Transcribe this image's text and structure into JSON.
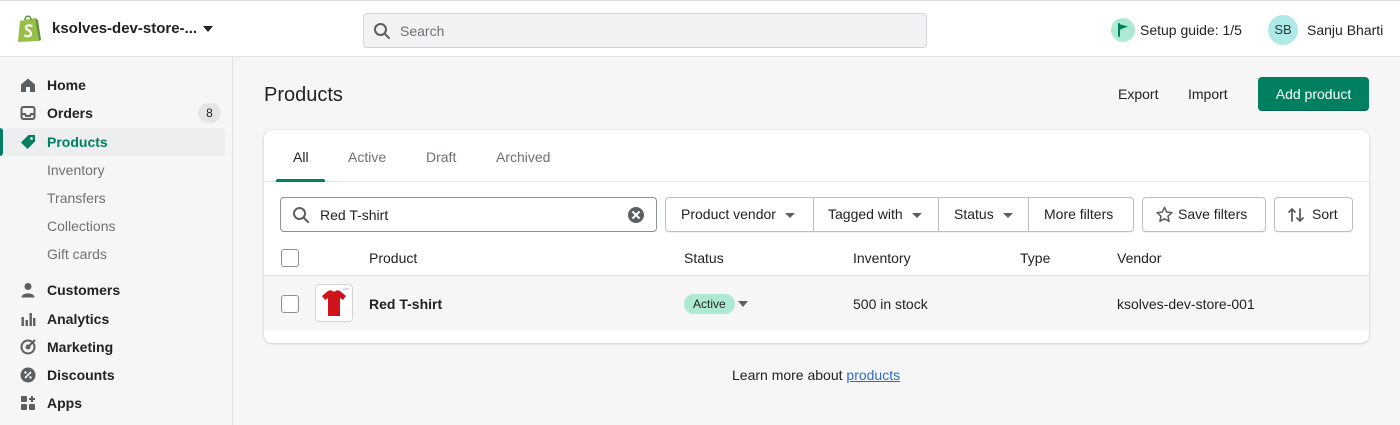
{
  "topbar": {
    "store_name": "ksolves-dev-store-...",
    "search_placeholder": "Search",
    "setup_guide": "Setup guide: 1/5",
    "user_initials": "SB",
    "user_name": "Sanju Bharti"
  },
  "sidebar": {
    "items": [
      {
        "label": "Home",
        "icon": "home-icon"
      },
      {
        "label": "Orders",
        "icon": "orders-icon",
        "badge": "8"
      },
      {
        "label": "Products",
        "icon": "tag-icon",
        "active": true
      },
      {
        "label": "Inventory",
        "sub": true
      },
      {
        "label": "Transfers",
        "sub": true
      },
      {
        "label": "Collections",
        "sub": true
      },
      {
        "label": "Gift cards",
        "sub": true
      },
      {
        "label": "Customers",
        "icon": "person-icon"
      },
      {
        "label": "Analytics",
        "icon": "bar-chart-icon"
      },
      {
        "label": "Marketing",
        "icon": "target-icon"
      },
      {
        "label": "Discounts",
        "icon": "discount-icon"
      },
      {
        "label": "Apps",
        "icon": "apps-icon"
      }
    ]
  },
  "page": {
    "title": "Products",
    "export_label": "Export",
    "import_label": "Import",
    "add_label": "Add product"
  },
  "tabs": [
    "All",
    "Active",
    "Draft",
    "Archived"
  ],
  "filters": {
    "search_value": "Red T-shirt",
    "vendor": "Product vendor",
    "tagged": "Tagged with",
    "status": "Status",
    "more": "More filters",
    "save": "Save filters",
    "sort": "Sort"
  },
  "table": {
    "columns": [
      "Product",
      "Status",
      "Inventory",
      "Type",
      "Vendor"
    ],
    "rows": [
      {
        "product": "Red T-shirt",
        "status": "Active",
        "inventory": "500 in stock",
        "type": "",
        "vendor": "ksolves-dev-store-001"
      }
    ]
  },
  "footer": {
    "text": "Learn more about ",
    "link": "products"
  },
  "colors": {
    "accent": "#008060",
    "status_active": "#aee9d1",
    "link": "#2c6ecb"
  }
}
